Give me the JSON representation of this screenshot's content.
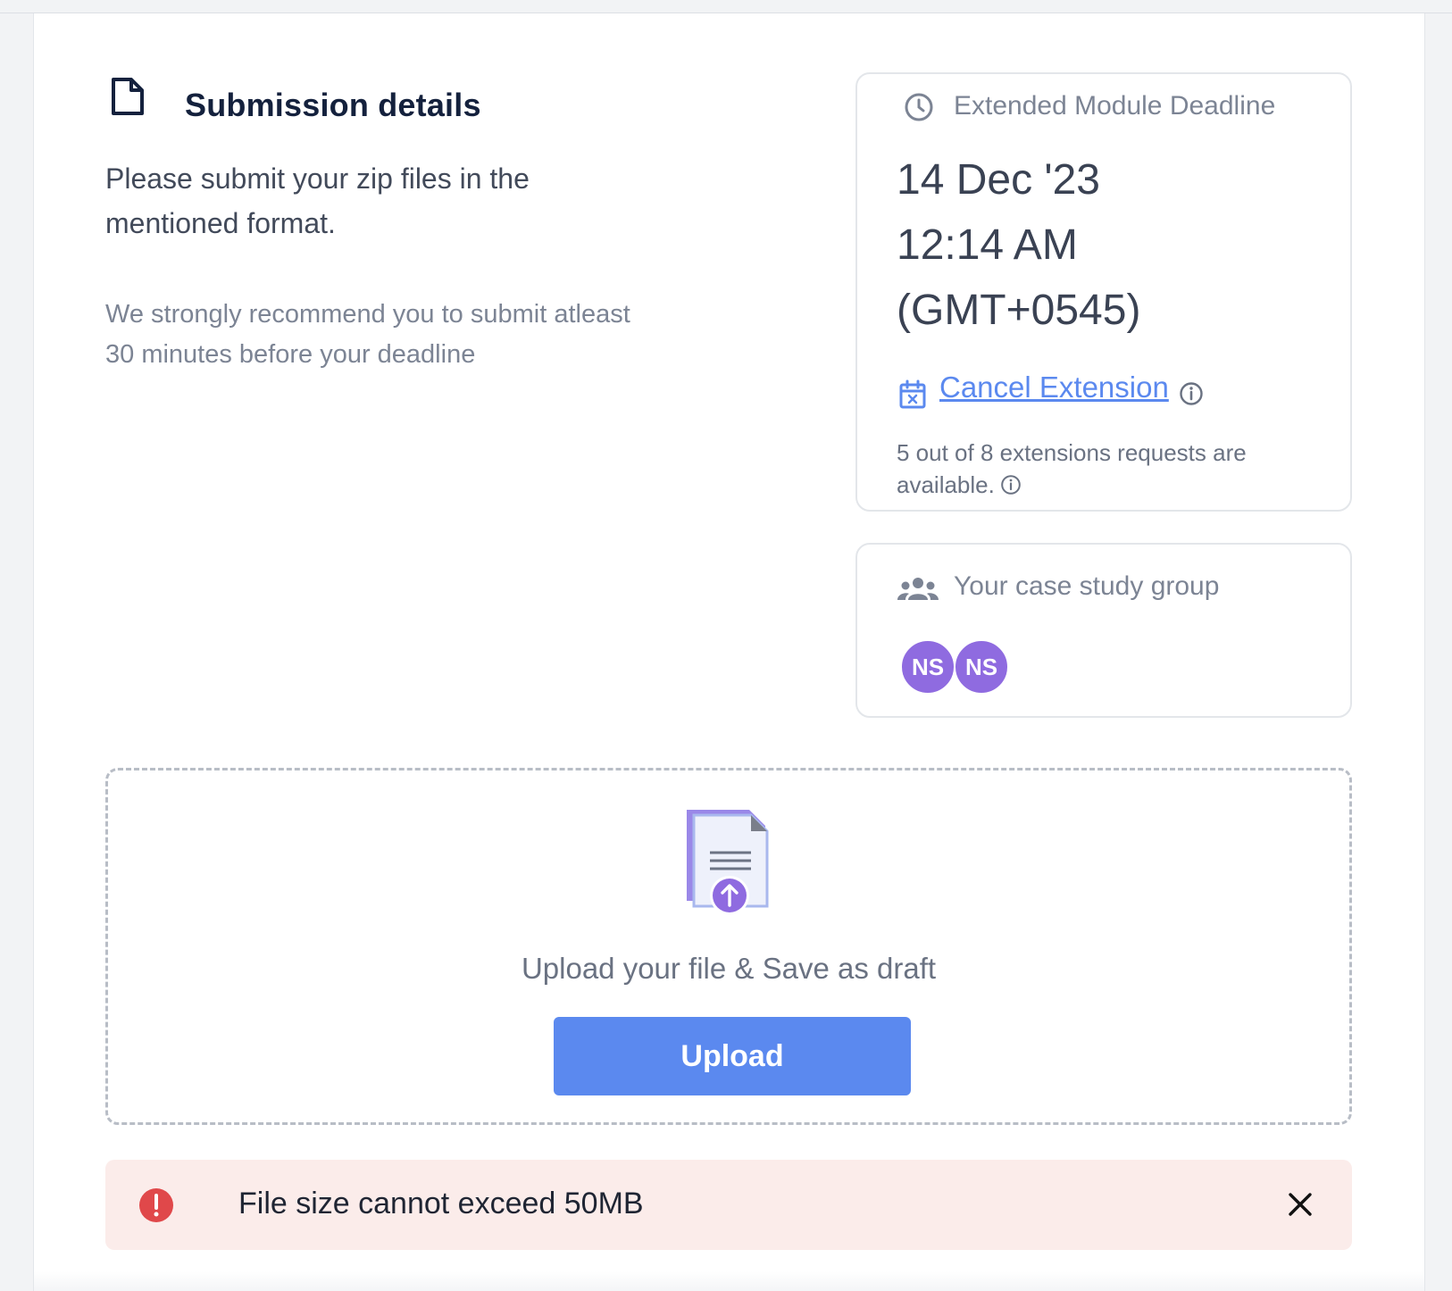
{
  "submission": {
    "title": "Submission details",
    "instructions": "Please submit your zip files in the mentioned format.",
    "recommendation": "We strongly recommend you to submit atleast 30 minutes before your deadline",
    "icon": "document-icon"
  },
  "deadline": {
    "heading": "Extended Module Deadline",
    "date": "14 Dec '23",
    "time": "12:14 AM",
    "timezone": "(GMT+0545)",
    "cancel_label": "Cancel Extension",
    "extensions_note": "5 out of 8 extensions requests are available.",
    "icons": [
      "clock-icon",
      "calendar-x-icon",
      "info-icon"
    ]
  },
  "group": {
    "heading": "Your case study group",
    "members": [
      "NS",
      "NS"
    ],
    "icon": "group-icon"
  },
  "upload": {
    "label": "Upload your file & Save as draft",
    "button_label": "Upload",
    "icon": "upload-file-icon"
  },
  "error": {
    "message": "File size cannot exceed 50MB",
    "icons": [
      "error-icon",
      "close-icon"
    ]
  },
  "colors": {
    "accent": "#5b89ef",
    "avatar": "#8f6be0",
    "error_bg": "#fbecea",
    "error_icon": "#e0484a",
    "title": "#14213d"
  }
}
